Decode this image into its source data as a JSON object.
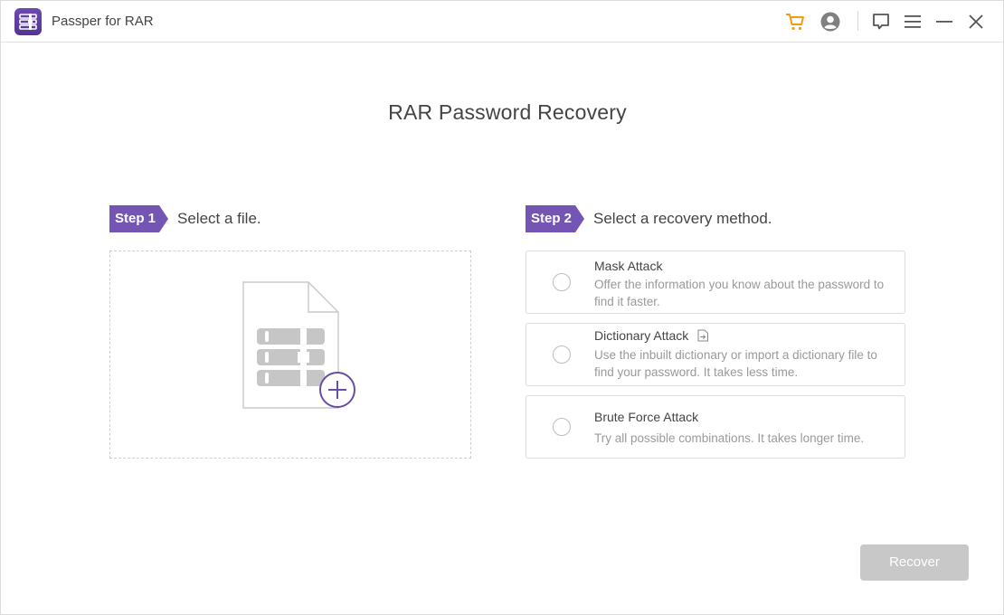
{
  "app": {
    "title": "Passper for RAR",
    "logo_icon": "archive-logo-icon"
  },
  "titlebar": {
    "icons": [
      "cart-icon",
      "account-icon",
      "feedback-icon",
      "menu-icon",
      "minimize-icon",
      "close-icon"
    ],
    "colors": {
      "cart": "#f39c12",
      "icons": "#666666"
    }
  },
  "main": {
    "title": "RAR Password Recovery"
  },
  "step1": {
    "badge": "Step 1",
    "label": "Select a file.",
    "dropzone_icon": "rar-file-add-icon"
  },
  "step2": {
    "badge": "Step 2",
    "label": "Select a recovery method.",
    "options": [
      {
        "title": "Mask Attack",
        "description": "Offer the information you know about the password to find it faster.",
        "selected": false
      },
      {
        "title": "Dictionary Attack",
        "description": "Use the inbuilt dictionary or import a dictionary file to find your password. It takes less time.",
        "selected": false,
        "extra_icon": "import-file-icon"
      },
      {
        "title": "Brute Force Attack",
        "description": "Try all possible combinations. It takes longer time.",
        "selected": false
      }
    ]
  },
  "footer": {
    "recover_label": "Recover",
    "recover_enabled": false
  },
  "colors": {
    "accent": "#7455b3",
    "disabled_button": "#c8c8c8"
  }
}
